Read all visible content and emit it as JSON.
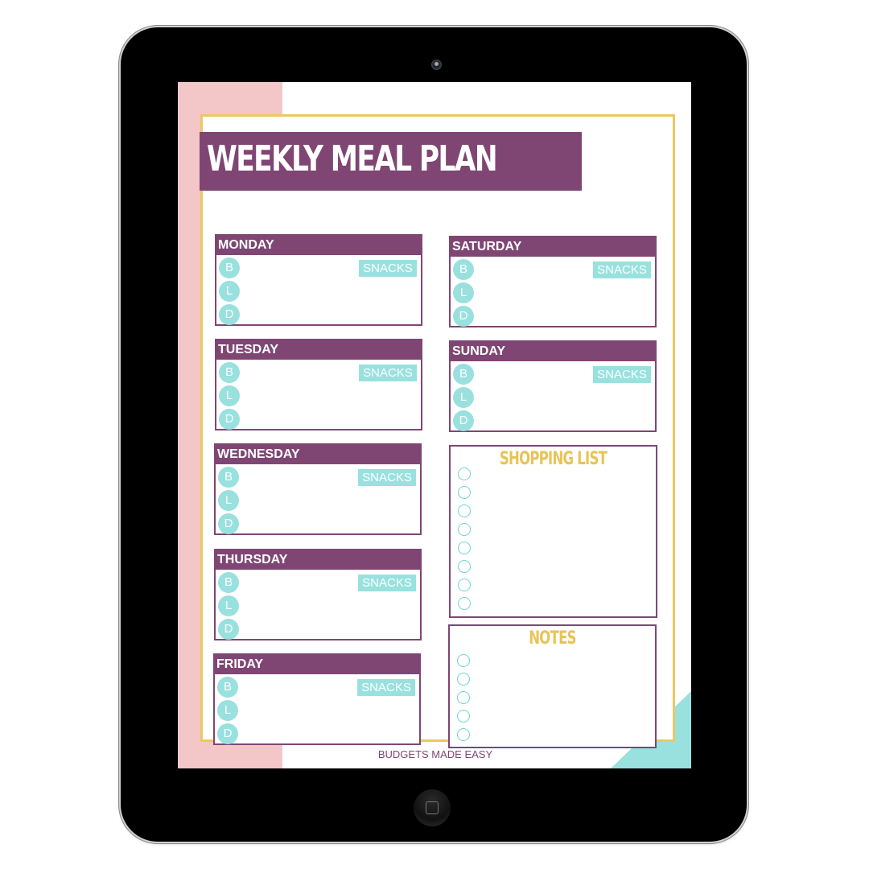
{
  "device": {
    "type": "tablet"
  },
  "document": {
    "title": "WEEKLY MEAL PLAN",
    "footer": "BUDGETS MADE EASY",
    "colors": {
      "purple": "#7f4674",
      "teal": "#99e1df",
      "pink": "#f3c6c7",
      "gold": "#ecc85f"
    },
    "meal_labels": {
      "breakfast": "B",
      "lunch": "L",
      "dinner": "D"
    },
    "snacks_label": "SNACKS",
    "days": [
      {
        "name": "MONDAY"
      },
      {
        "name": "TUESDAY"
      },
      {
        "name": "WEDNESDAY"
      },
      {
        "name": "THURSDAY"
      },
      {
        "name": "FRIDAY"
      },
      {
        "name": "SATURDAY"
      },
      {
        "name": "SUNDAY"
      }
    ],
    "shopping_list": {
      "title": "SHOPPING LIST",
      "items_count": 8
    },
    "notes": {
      "title": "NOTES",
      "items_count": 5
    }
  }
}
